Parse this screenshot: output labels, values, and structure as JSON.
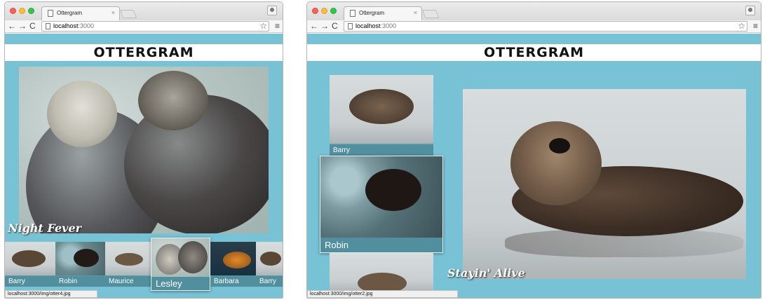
{
  "browser": {
    "tab_title": "Ottergram",
    "url_host": "localhost",
    "url_port": ":3000",
    "tab_close_glyph": "×",
    "back_glyph": "←",
    "forward_glyph": "→",
    "reload_glyph": "C",
    "star_glyph": "☆",
    "menu_glyph": "≡"
  },
  "site": {
    "logo": "OTTERGRAM"
  },
  "left": {
    "detail_caption": "Night Fever",
    "thumbs": [
      "Barry",
      "Robin",
      "Maurice",
      "Lesley",
      "Barbara",
      "Barry"
    ],
    "status": "localhost:3000/img/otter4.jpg"
  },
  "right": {
    "thumbs": [
      "Barry",
      "Robin",
      ""
    ],
    "detail_caption": "Stayin' Alive",
    "status": "localhost:3000/img/otter2.jpg"
  },
  "colors": {
    "accent": "#78c2d6"
  }
}
